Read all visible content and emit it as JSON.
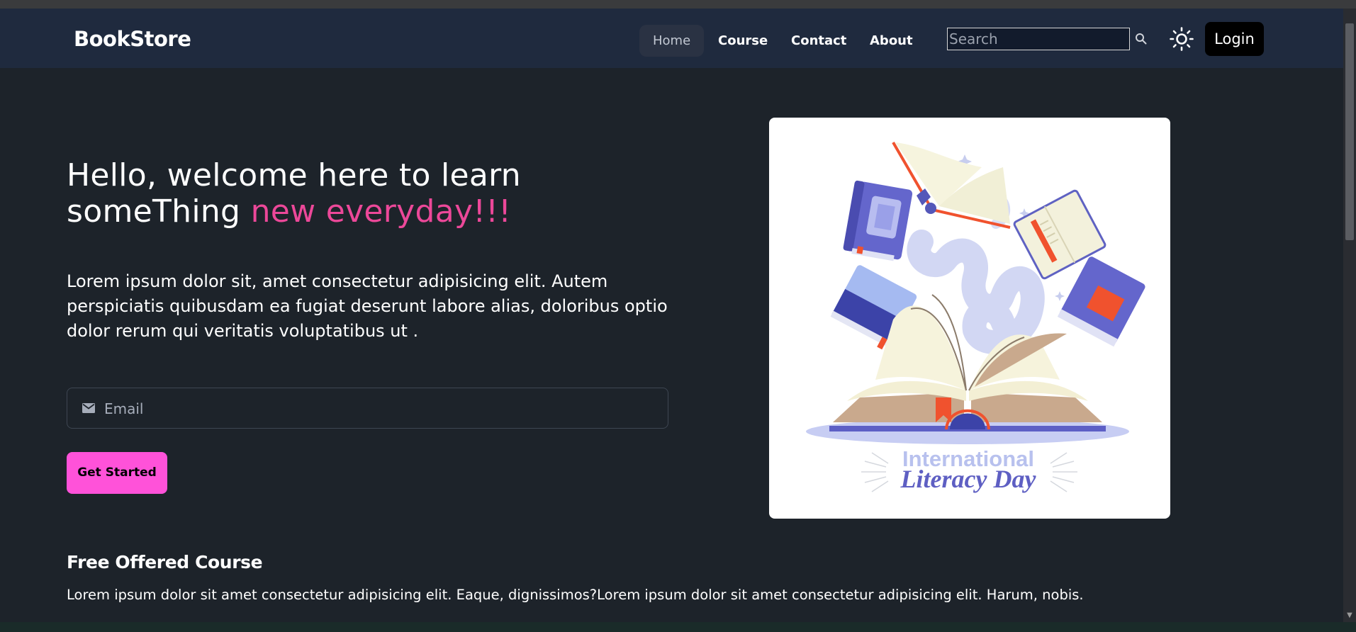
{
  "brand": "BookStore",
  "nav": {
    "items": [
      {
        "label": "Home",
        "active": true
      },
      {
        "label": "Course",
        "active": false
      },
      {
        "label": "Contact",
        "active": false
      },
      {
        "label": "About",
        "active": false
      }
    ],
    "search_placeholder": "Search",
    "login_label": "Login"
  },
  "hero": {
    "title_part1": "Hello, welcome here to learn someThing ",
    "title_accent": "new everyday!!!",
    "description": "Lorem ipsum dolor sit, amet consectetur adipisicing elit. Autem perspiciatis quibusdam ea fugiat deserunt labore alias, doloribus optio dolor rerum qui veritatis voluptatibus ut .",
    "email_placeholder": "Email",
    "cta_label": "Get Started",
    "illustration": {
      "line1": "International",
      "line2": "Literacy Day"
    }
  },
  "section": {
    "title": "Free Offered Course",
    "description": "Lorem ipsum dolor sit amet consectetur adipisicing elit. Eaque, dignissimos?Lorem ipsum dolor sit amet consectetur adipisicing elit. Harum, nobis."
  },
  "colors": {
    "accent_pink": "#ec4899",
    "cta_pink": "#ff52d9",
    "navbar": "#1f2a3e",
    "background": "#1d232a"
  }
}
